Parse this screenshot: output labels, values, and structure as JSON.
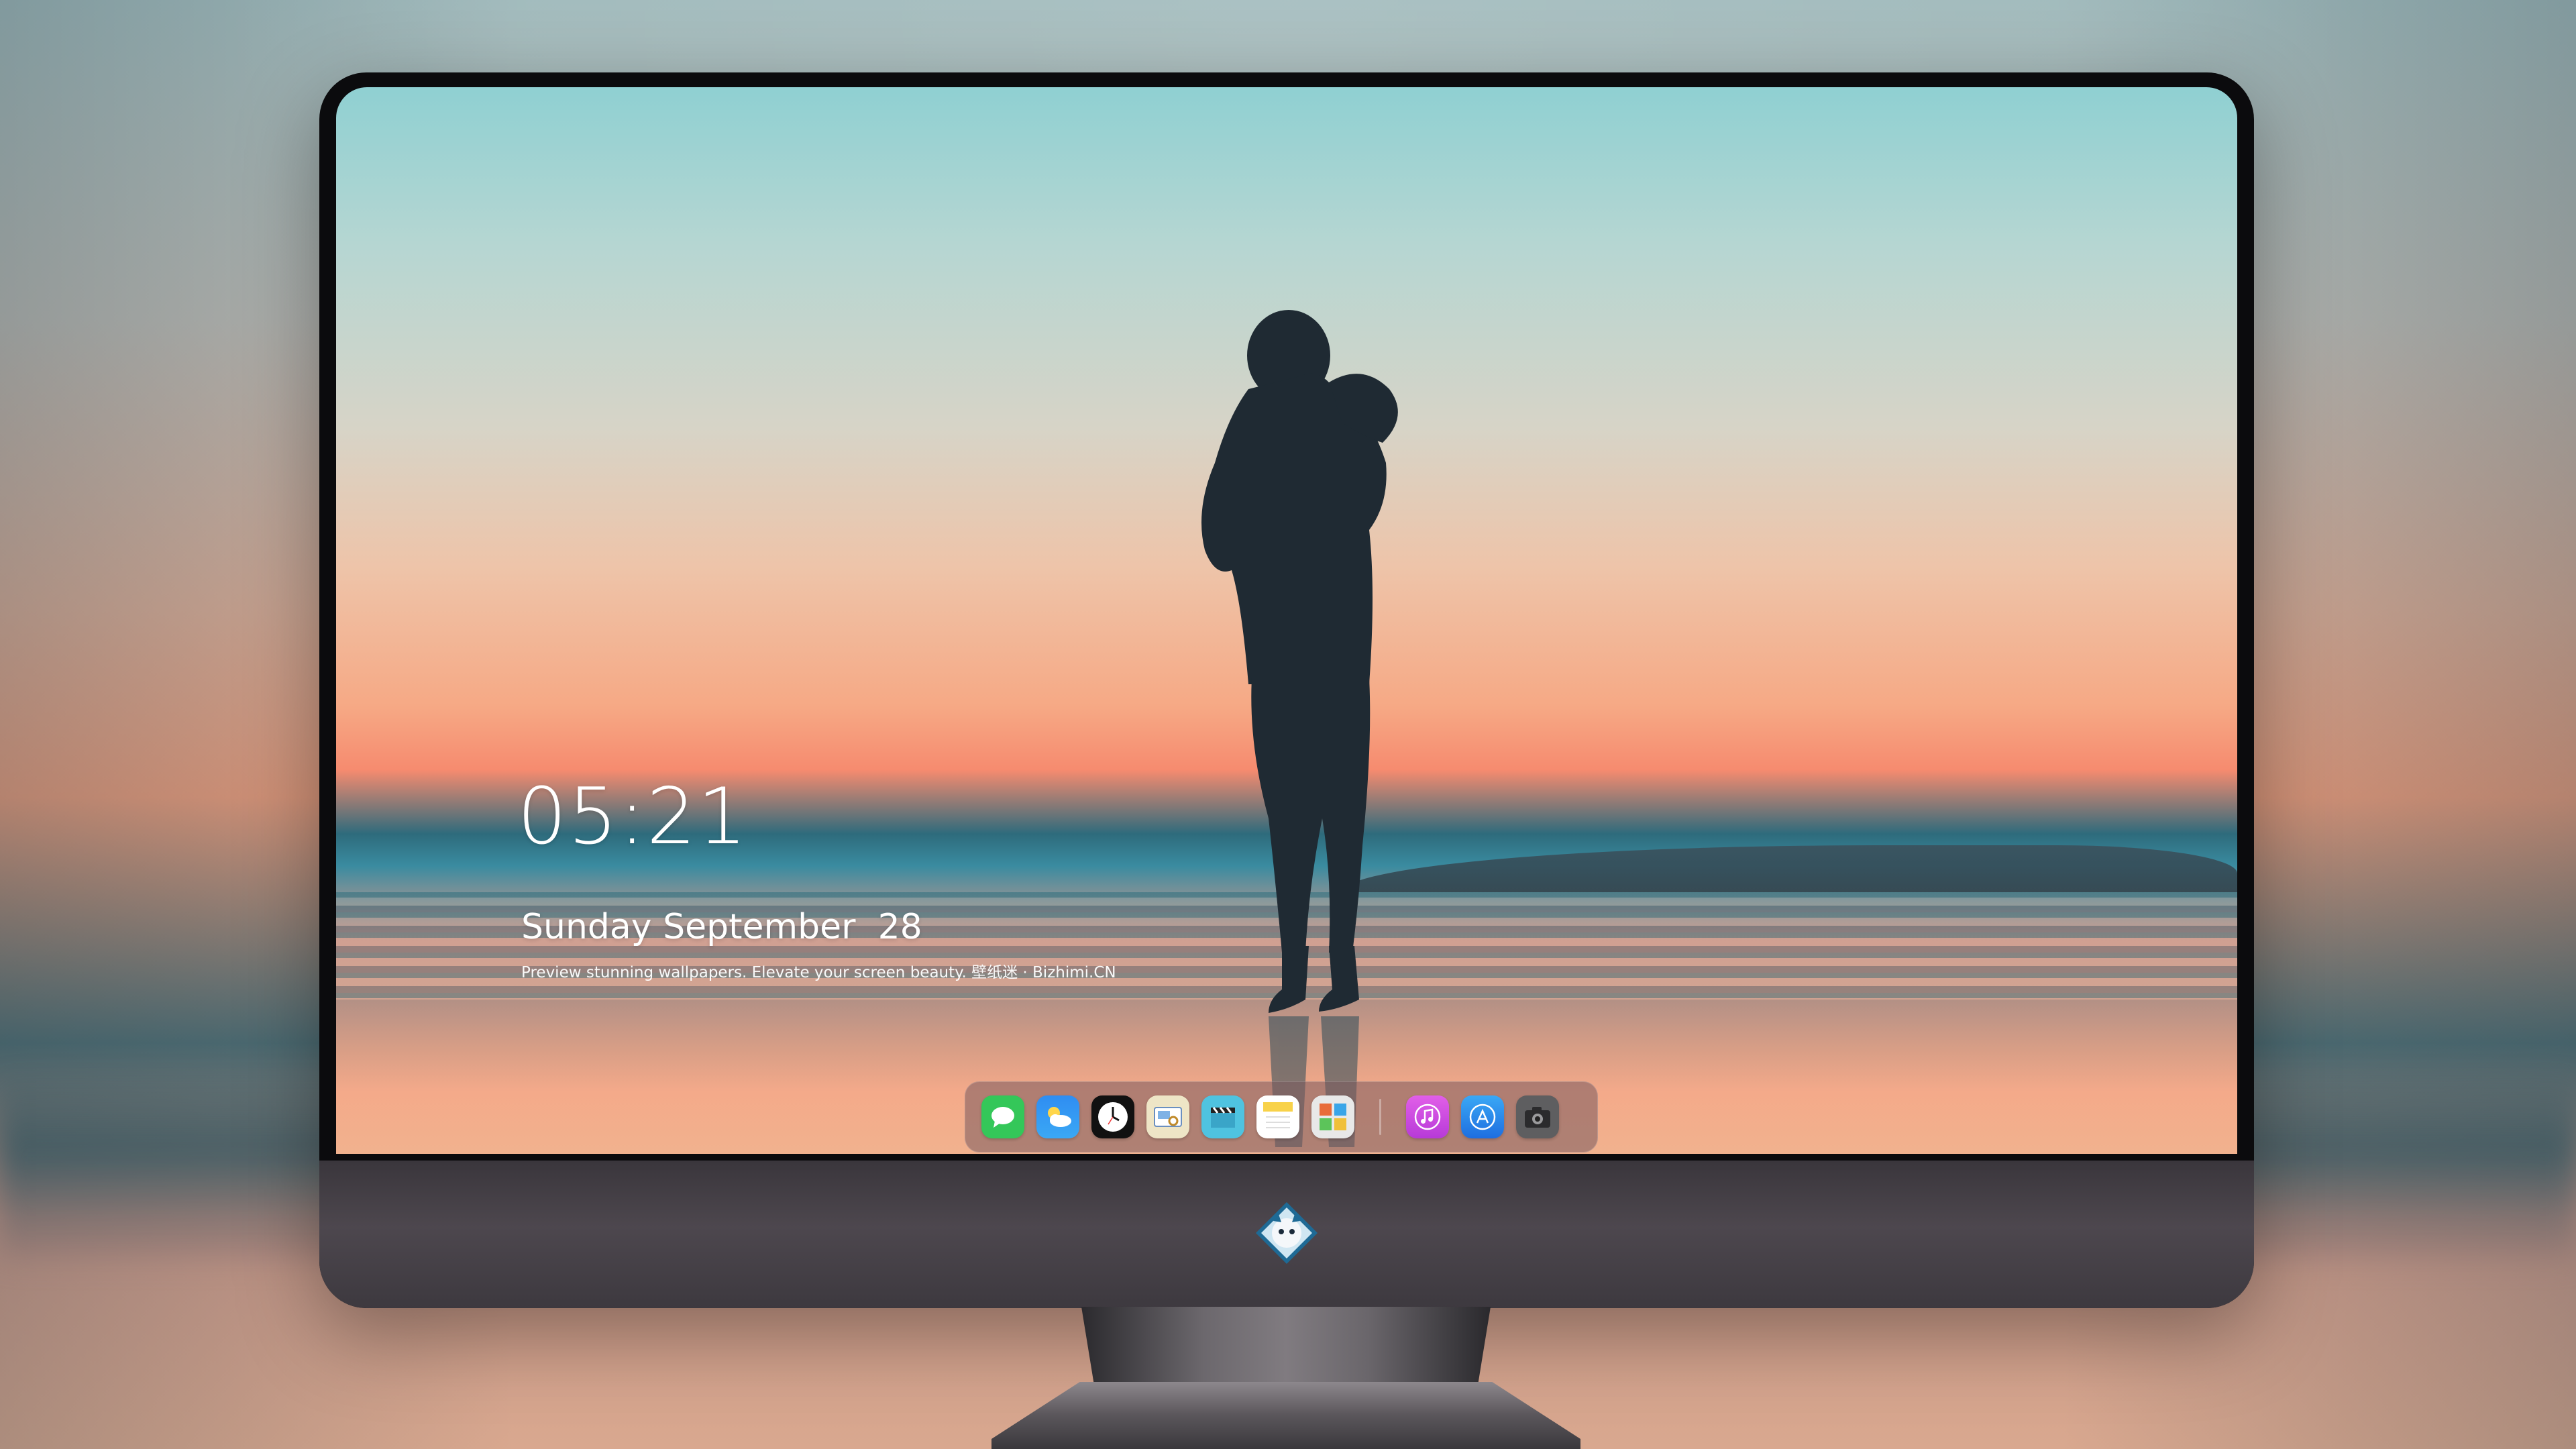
{
  "lockscreen": {
    "time": "05:21",
    "date": "Sunday September  28",
    "tagline": "Preview stunning wallpapers. Elevate your screen beauty. 壁纸迷 · Bizhimi.CN"
  },
  "dock": {
    "apps": [
      {
        "name": "messages",
        "color": "#36c759"
      },
      {
        "name": "weather",
        "color": "#2e8ff0"
      },
      {
        "name": "clock",
        "color": "#111111"
      },
      {
        "name": "preview",
        "color": "#e9e2c8"
      },
      {
        "name": "clapper",
        "color": "#4fc3e0"
      },
      {
        "name": "notes",
        "color": "#f8d24a"
      },
      {
        "name": "photo-booth",
        "color": "#e9e9e9"
      },
      {
        "name": "music",
        "color": "#d24be0"
      },
      {
        "name": "app-store",
        "color": "#2d8cf0"
      },
      {
        "name": "camera",
        "color": "#6a6a6a"
      }
    ]
  }
}
